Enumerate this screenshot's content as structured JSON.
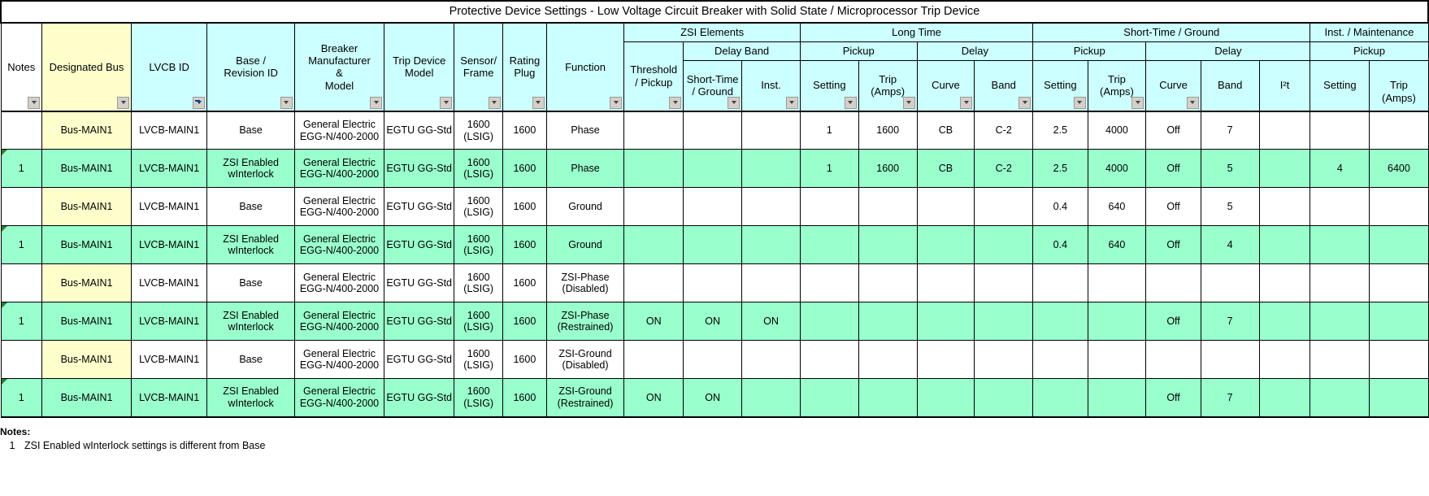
{
  "title": "Protective Device Settings - Low Voltage Circuit Breaker with Solid State / Microprocessor Trip Device",
  "colors": {
    "header_fill": "#CCFFFF",
    "bus_fill": "#FFFFCC",
    "zsi_row_fill": "#99FFCC",
    "base_row_fill": "#FFFFFF",
    "grid_line": "#000000",
    "flag_marker": "#2E7D32"
  },
  "header": {
    "groups_top": [
      {
        "label": "ZSI Elements",
        "span": 3
      },
      {
        "label": "Long Time",
        "span": 4
      },
      {
        "label": "Short-Time / Ground",
        "span": 5
      },
      {
        "label": "Inst. / Maintenance",
        "span": 2
      }
    ],
    "groups_mid": [
      {
        "label": "Delay Band",
        "span": 2
      },
      {
        "label": "Pickup",
        "span": 2
      },
      {
        "label": "Delay",
        "span": 2
      },
      {
        "label": "Pickup",
        "span": 2
      },
      {
        "label": "Delay",
        "span": 3
      },
      {
        "label": "Pickup",
        "span": 2
      }
    ],
    "columns": [
      {
        "key": "notes",
        "label": "Notes",
        "filter": true,
        "filter_active": false
      },
      {
        "key": "bus",
        "label": "Designated Bus",
        "filter": true,
        "filter_active": false
      },
      {
        "key": "lvcb_id",
        "label": "LVCB ID",
        "filter": true,
        "filter_active": true
      },
      {
        "key": "base_rev",
        "label": "Base /\nRevision ID",
        "filter": true,
        "filter_active": false
      },
      {
        "key": "breaker",
        "label": "Breaker\nManufacturer\n&\nModel",
        "filter": true,
        "filter_active": false
      },
      {
        "key": "trip_model",
        "label": "Trip Device\nModel",
        "filter": true,
        "filter_active": false
      },
      {
        "key": "sensor",
        "label": "Sensor/\nFrame",
        "filter": true,
        "filter_active": false
      },
      {
        "key": "rating_plug",
        "label": "Rating\nPlug",
        "filter": true,
        "filter_active": false
      },
      {
        "key": "function",
        "label": "Function",
        "filter": true,
        "filter_active": false
      },
      {
        "key": "zsi_thresh",
        "label": "Threshold\n/ Pickup",
        "filter": true,
        "filter_active": false
      },
      {
        "key": "zsi_st_gnd",
        "label": "Short-Time\n/ Ground",
        "filter": true,
        "filter_active": false
      },
      {
        "key": "zsi_inst",
        "label": "Inst.",
        "filter": true,
        "filter_active": false
      },
      {
        "key": "lt_setting",
        "label": "Setting",
        "filter": true,
        "filter_active": false
      },
      {
        "key": "lt_trip",
        "label": "Trip\n(Amps)",
        "filter": true,
        "filter_active": false
      },
      {
        "key": "lt_curve",
        "label": "Curve",
        "filter": true,
        "filter_active": false
      },
      {
        "key": "lt_band",
        "label": "Band",
        "filter": true,
        "filter_active": false
      },
      {
        "key": "st_setting",
        "label": "Setting",
        "filter": true,
        "filter_active": false
      },
      {
        "key": "st_trip",
        "label": "Trip\n(Amps)",
        "filter": true,
        "filter_active": false
      },
      {
        "key": "st_curve",
        "label": "Curve",
        "filter": true,
        "filter_active": false
      },
      {
        "key": "st_band",
        "label": "Band",
        "filter": false,
        "filter_active": false
      },
      {
        "key": "st_i2t",
        "label": "I²t",
        "filter": false,
        "filter_active": false
      },
      {
        "key": "inst_setting",
        "label": "Setting",
        "filter": false,
        "filter_active": false
      },
      {
        "key": "inst_trip",
        "label": "Trip\n(Amps)",
        "filter": false,
        "filter_active": false
      }
    ]
  },
  "rows": [
    {
      "style": "base",
      "flag": false,
      "notes": "",
      "bus": "Bus-MAIN1",
      "lvcb_id": "LVCB-MAIN1",
      "base_rev": "Base",
      "breaker": "General Electric\nEGG-N/400-2000",
      "trip_model": "EGTU GG-Std",
      "sensor": "1600\n(LSIG)",
      "rating_plug": "1600",
      "function": "Phase",
      "zsi_thresh": "",
      "zsi_st_gnd": "",
      "zsi_inst": "",
      "lt_setting": "1",
      "lt_trip": "1600",
      "lt_curve": "CB",
      "lt_band": "C-2",
      "st_setting": "2.5",
      "st_trip": "4000",
      "st_curve": "Off",
      "st_band": "7",
      "st_i2t": "",
      "inst_setting": "",
      "inst_trip": ""
    },
    {
      "style": "zsi",
      "flag": true,
      "notes": "1",
      "bus": "Bus-MAIN1",
      "lvcb_id": "LVCB-MAIN1",
      "base_rev": "ZSI Enabled\nwInterlock",
      "breaker": "General Electric\nEGG-N/400-2000",
      "trip_model": "EGTU GG-Std",
      "sensor": "1600\n(LSIG)",
      "rating_plug": "1600",
      "function": "Phase",
      "zsi_thresh": "",
      "zsi_st_gnd": "",
      "zsi_inst": "",
      "lt_setting": "1",
      "lt_trip": "1600",
      "lt_curve": "CB",
      "lt_band": "C-2",
      "st_setting": "2.5",
      "st_trip": "4000",
      "st_curve": "Off",
      "st_band": "5",
      "st_i2t": "",
      "inst_setting": "4",
      "inst_trip": "6400"
    },
    {
      "style": "base",
      "flag": false,
      "notes": "",
      "bus": "Bus-MAIN1",
      "lvcb_id": "LVCB-MAIN1",
      "base_rev": "Base",
      "breaker": "General Electric\nEGG-N/400-2000",
      "trip_model": "EGTU GG-Std",
      "sensor": "1600\n(LSIG)",
      "rating_plug": "1600",
      "function": "Ground",
      "zsi_thresh": "",
      "zsi_st_gnd": "",
      "zsi_inst": "",
      "lt_setting": "",
      "lt_trip": "",
      "lt_curve": "",
      "lt_band": "",
      "st_setting": "0.4",
      "st_trip": "640",
      "st_curve": "Off",
      "st_band": "5",
      "st_i2t": "",
      "inst_setting": "",
      "inst_trip": ""
    },
    {
      "style": "zsi",
      "flag": true,
      "notes": "1",
      "bus": "Bus-MAIN1",
      "lvcb_id": "LVCB-MAIN1",
      "base_rev": "ZSI Enabled\nwInterlock",
      "breaker": "General Electric\nEGG-N/400-2000",
      "trip_model": "EGTU GG-Std",
      "sensor": "1600\n(LSIG)",
      "rating_plug": "1600",
      "function": "Ground",
      "zsi_thresh": "",
      "zsi_st_gnd": "",
      "zsi_inst": "",
      "lt_setting": "",
      "lt_trip": "",
      "lt_curve": "",
      "lt_band": "",
      "st_setting": "0.4",
      "st_trip": "640",
      "st_curve": "Off",
      "st_band": "4",
      "st_i2t": "",
      "inst_setting": "",
      "inst_trip": ""
    },
    {
      "style": "base",
      "flag": false,
      "notes": "",
      "bus": "Bus-MAIN1",
      "lvcb_id": "LVCB-MAIN1",
      "base_rev": "Base",
      "breaker": "General Electric\nEGG-N/400-2000",
      "trip_model": "EGTU GG-Std",
      "sensor": "1600\n(LSIG)",
      "rating_plug": "1600",
      "function": "ZSI-Phase\n(Disabled)",
      "zsi_thresh": "",
      "zsi_st_gnd": "",
      "zsi_inst": "",
      "lt_setting": "",
      "lt_trip": "",
      "lt_curve": "",
      "lt_band": "",
      "st_setting": "",
      "st_trip": "",
      "st_curve": "",
      "st_band": "",
      "st_i2t": "",
      "inst_setting": "",
      "inst_trip": ""
    },
    {
      "style": "zsi",
      "flag": true,
      "notes": "1",
      "bus": "Bus-MAIN1",
      "lvcb_id": "LVCB-MAIN1",
      "base_rev": "ZSI Enabled\nwInterlock",
      "breaker": "General Electric\nEGG-N/400-2000",
      "trip_model": "EGTU GG-Std",
      "sensor": "1600\n(LSIG)",
      "rating_plug": "1600",
      "function": "ZSI-Phase\n(Restrained)",
      "zsi_thresh": "ON",
      "zsi_st_gnd": "ON",
      "zsi_inst": "ON",
      "lt_setting": "",
      "lt_trip": "",
      "lt_curve": "",
      "lt_band": "",
      "st_setting": "",
      "st_trip": "",
      "st_curve": "Off",
      "st_band": "7",
      "st_i2t": "",
      "inst_setting": "",
      "inst_trip": ""
    },
    {
      "style": "base",
      "flag": false,
      "notes": "",
      "bus": "Bus-MAIN1",
      "lvcb_id": "LVCB-MAIN1",
      "base_rev": "Base",
      "breaker": "General Electric\nEGG-N/400-2000",
      "trip_model": "EGTU GG-Std",
      "sensor": "1600\n(LSIG)",
      "rating_plug": "1600",
      "function": "ZSI-Ground\n(Disabled)",
      "zsi_thresh": "",
      "zsi_st_gnd": "",
      "zsi_inst": "",
      "lt_setting": "",
      "lt_trip": "",
      "lt_curve": "",
      "lt_band": "",
      "st_setting": "",
      "st_trip": "",
      "st_curve": "",
      "st_band": "",
      "st_i2t": "",
      "inst_setting": "",
      "inst_trip": ""
    },
    {
      "style": "zsi",
      "flag": true,
      "notes": "1",
      "bus": "Bus-MAIN1",
      "lvcb_id": "LVCB-MAIN1",
      "base_rev": "ZSI Enabled\nwInterlock",
      "breaker": "General Electric\nEGG-N/400-2000",
      "trip_model": "EGTU GG-Std",
      "sensor": "1600\n(LSIG)",
      "rating_plug": "1600",
      "function": "ZSI-Ground\n(Restrained)",
      "zsi_thresh": "ON",
      "zsi_st_gnd": "ON",
      "zsi_inst": "",
      "lt_setting": "",
      "lt_trip": "",
      "lt_curve": "",
      "lt_band": "",
      "st_setting": "",
      "st_trip": "",
      "st_curve": "Off",
      "st_band": "7",
      "st_i2t": "",
      "inst_setting": "",
      "inst_trip": ""
    }
  ],
  "notes": {
    "heading": "Notes:",
    "items": [
      {
        "number": "1",
        "text": "ZSI Enabled wInterlock settings is different from Base"
      }
    ]
  }
}
